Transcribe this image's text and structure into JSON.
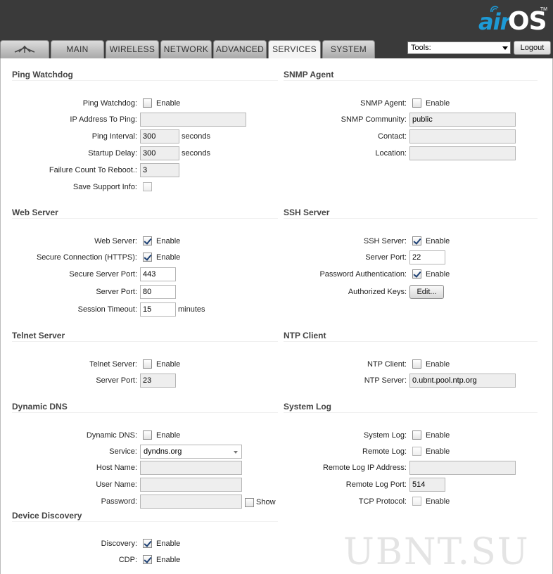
{
  "brand": {
    "air": "air",
    "os": "OS",
    "tm": "TM"
  },
  "tabs": [
    {
      "label": "MAIN"
    },
    {
      "label": "WIRELESS"
    },
    {
      "label": "NETWORK"
    },
    {
      "label": "ADVANCED"
    },
    {
      "label": "SERVICES"
    },
    {
      "label": "SYSTEM"
    }
  ],
  "tools": {
    "label": "Tools:"
  },
  "logout_label": "Logout",
  "enable": "Enable",
  "ping": {
    "title": "Ping Watchdog",
    "watchdog_label": "Ping Watchdog:",
    "ip_label": "IP Address To Ping:",
    "ip_value": "",
    "interval_label": "Ping Interval:",
    "interval_value": "300",
    "interval_unit": "seconds",
    "startup_label": "Startup Delay:",
    "startup_value": "300",
    "startup_unit": "seconds",
    "failure_label": "Failure Count To Reboot.:",
    "failure_value": "3",
    "support_label": "Save Support Info:"
  },
  "snmp": {
    "title": "SNMP Agent",
    "agent_label": "SNMP Agent:",
    "community_label": "SNMP Community:",
    "community_value": "public",
    "contact_label": "Contact:",
    "contact_value": "",
    "location_label": "Location:",
    "location_value": ""
  },
  "web": {
    "title": "Web Server",
    "server_label": "Web Server:",
    "https_label": "Secure Connection (HTTPS):",
    "secure_port_label": "Secure Server Port:",
    "secure_port_value": "443",
    "port_label": "Server Port:",
    "port_value": "80",
    "timeout_label": "Session Timeout:",
    "timeout_value": "15",
    "timeout_unit": "minutes"
  },
  "ssh": {
    "title": "SSH Server",
    "server_label": "SSH Server:",
    "port_label": "Server Port:",
    "port_value": "22",
    "password_label": "Password Authentication:",
    "keys_label": "Authorized Keys:",
    "edit_label": "Edit..."
  },
  "telnet": {
    "title": "Telnet Server",
    "server_label": "Telnet Server:",
    "port_label": "Server Port:",
    "port_value": "23"
  },
  "ntp": {
    "title": "NTP Client",
    "client_label": "NTP Client:",
    "server_label": "NTP Server:",
    "server_value": "0.ubnt.pool.ntp.org"
  },
  "ddns": {
    "title": "Dynamic DNS",
    "ddns_label": "Dynamic DNS:",
    "service_label": "Service:",
    "service_value": "dyndns.org",
    "host_label": "Host Name:",
    "host_value": "",
    "user_label": "User Name:",
    "user_value": "",
    "password_label": "Password:",
    "password_value": "",
    "show_label": "Show"
  },
  "syslog": {
    "title": "System Log",
    "log_label": "System Log:",
    "remote_label": "Remote Log:",
    "remote_ip_label": "Remote Log IP Address:",
    "remote_ip_value": "",
    "remote_port_label": "Remote Log Port:",
    "remote_port_value": "514",
    "tcp_label": "TCP Protocol:"
  },
  "discovery": {
    "title": "Device Discovery",
    "discovery_label": "Discovery:",
    "cdp_label": "CDP:"
  },
  "watermark": "UBNT.SU"
}
